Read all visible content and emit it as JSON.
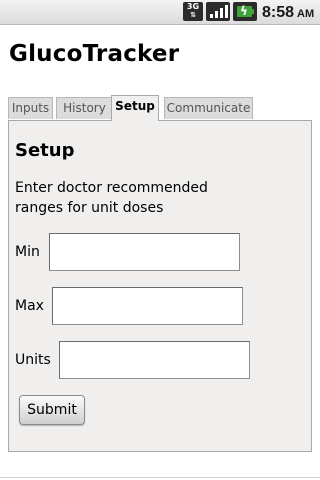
{
  "status_bar": {
    "network_label": "3G",
    "network_icon": "3g-data-icon",
    "signal_icon": "signal-strength-icon",
    "battery_icon": "battery-charging-icon",
    "time": "8:58",
    "ampm": "AM"
  },
  "app": {
    "title": "GlucoTracker"
  },
  "tabs": [
    {
      "label": "Inputs",
      "selected": false
    },
    {
      "label": "History",
      "selected": false
    },
    {
      "label": "Setup",
      "selected": true
    },
    {
      "label": "Communicate",
      "selected": false
    }
  ],
  "setup": {
    "heading": "Setup",
    "instructions": "Enter doctor recommended ranges for unit doses",
    "fields": {
      "min": {
        "label": "Min",
        "value": ""
      },
      "max": {
        "label": "Max",
        "value": ""
      },
      "units": {
        "label": "Units",
        "value": ""
      }
    },
    "submit_label": "Submit"
  },
  "colors": {
    "panel_bg": "#f1efed",
    "tab_inactive_bg": "#dcdcdc",
    "battery_accent": "#3fa13a"
  }
}
